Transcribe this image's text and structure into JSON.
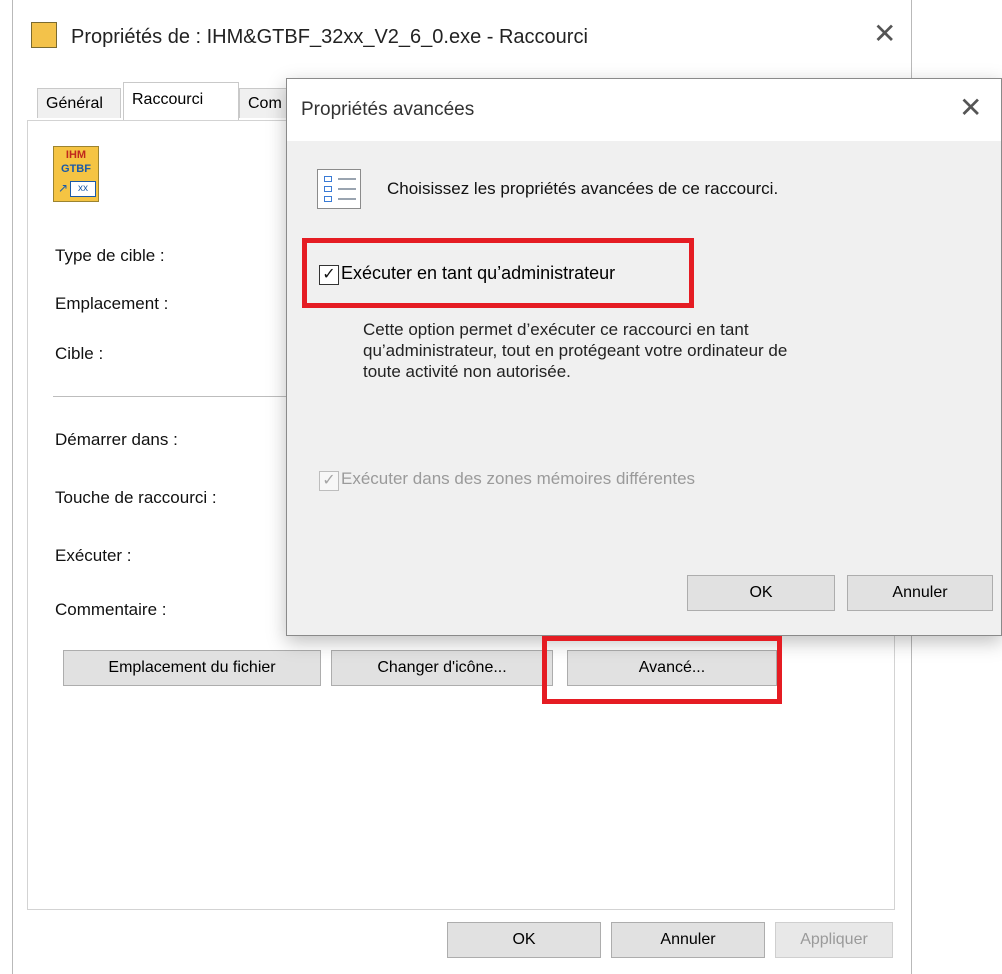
{
  "main_window": {
    "title": "Propriétés de : IHM&GTBF_32xx_V2_6_0.exe - Raccourci",
    "close_glyph": "✕",
    "app_icon": "ihm-gtbf-app-icon",
    "tabs": [
      {
        "label": "Général"
      },
      {
        "label": "Raccourci"
      },
      {
        "label": "Com"
      }
    ],
    "shortcut_icon": {
      "line1": "IHM",
      "line2": "GTBF",
      "line3": "xx",
      "arrow_glyph": "↗"
    },
    "fields": [
      {
        "label": "Type de cible :"
      },
      {
        "label": "Emplacement :"
      },
      {
        "label": "Cible :"
      },
      {
        "label": "Démarrer dans :"
      },
      {
        "label": "Touche de raccourci :"
      },
      {
        "label": "Exécuter :"
      },
      {
        "label": "Commentaire :"
      }
    ],
    "buttons": {
      "file_location": "Emplacement du fichier",
      "change_icon": "Changer d'icône...",
      "advanced": "Avancé...",
      "ok": "OK",
      "cancel": "Annuler",
      "apply": "Appliquer"
    }
  },
  "advanced_dialog": {
    "title": "Propriétés avancées",
    "close_glyph": "✕",
    "description": "Choisissez les propriétés avancées de ce raccourci.",
    "run_as_admin": {
      "label": "Exécuter en tant qu’administrateur",
      "checked": true,
      "check_glyph": "✓"
    },
    "admin_description": [
      "Cette option permet d’exécuter ce raccourci en tant",
      "qu’administrateur, tout en protégeant votre ordinateur de",
      "toute activité non autorisée."
    ],
    "separate_memory": {
      "label": "Exécuter dans des zones mémoires différentes",
      "checked": true,
      "enabled": false,
      "check_glyph": "✓"
    },
    "buttons": {
      "ok": "OK",
      "cancel": "Annuler"
    }
  },
  "highlight_color": "#e51c23"
}
